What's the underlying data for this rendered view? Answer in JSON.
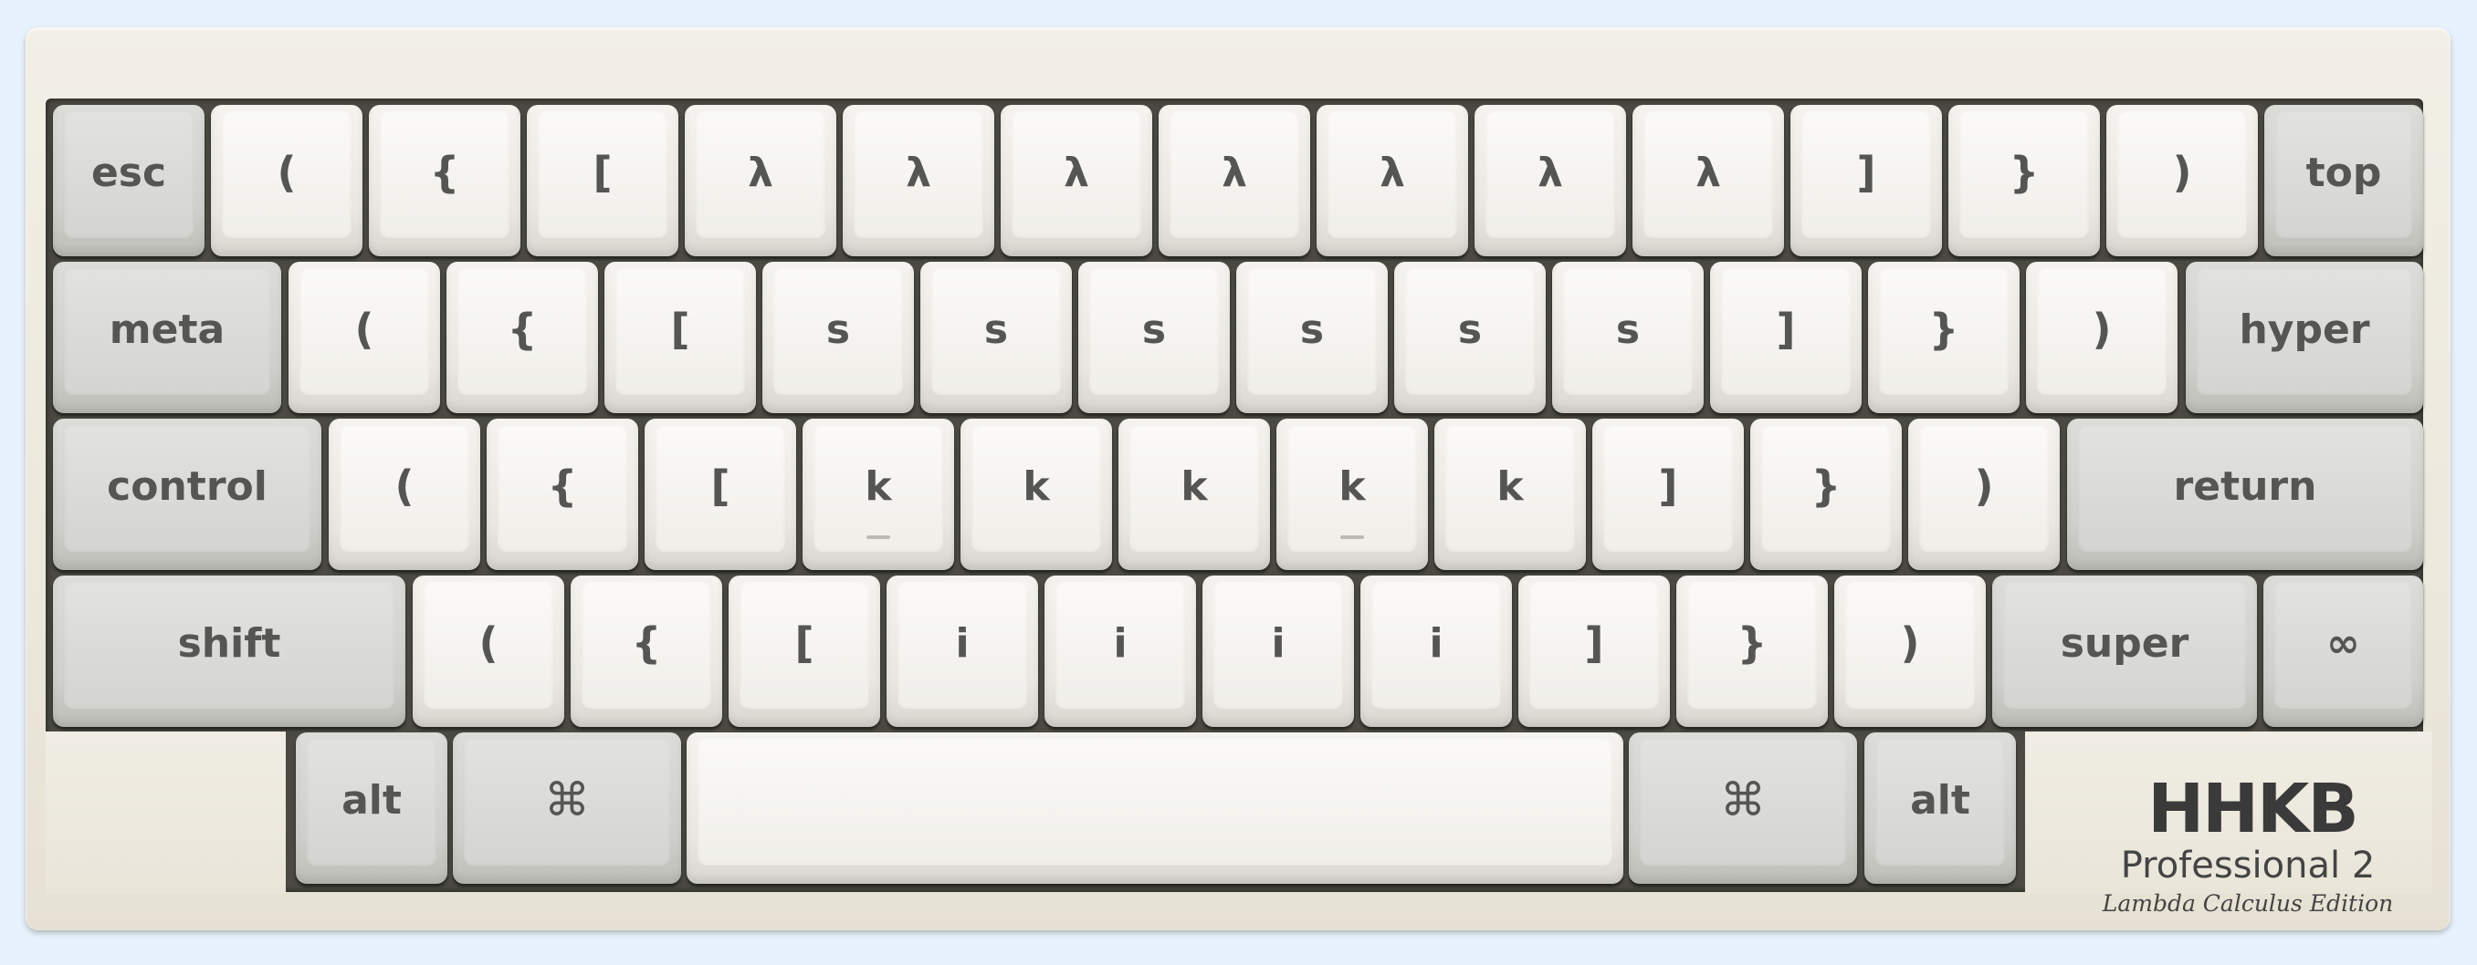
{
  "keyboard": {
    "row1": {
      "esc": "esc",
      "k1": "(",
      "k2": "{",
      "k3": "[",
      "k4": "λ",
      "k5": "λ",
      "k6": "λ",
      "k7": "λ",
      "k8": "λ",
      "k9": "λ",
      "k10": "λ",
      "k11": "]",
      "k12": "}",
      "k13": ")",
      "top": "top"
    },
    "row2": {
      "meta": "meta",
      "k1": "(",
      "k2": "{",
      "k3": "[",
      "k4": "s",
      "k5": "s",
      "k6": "s",
      "k7": "s",
      "k8": "s",
      "k9": "s",
      "k10": "]",
      "k11": "}",
      "k12": ")",
      "hyper": "hyper"
    },
    "row3": {
      "control": "control",
      "k1": "(",
      "k2": "{",
      "k3": "[",
      "k4": "k",
      "k5": "k",
      "k6": "k",
      "k7": "k",
      "k8": "k",
      "k9": "]",
      "k10": "}",
      "k11": ")",
      "return": "return"
    },
    "row4": {
      "shift": "shift",
      "k1": "(",
      "k2": "{",
      "k3": "[",
      "k4": "i",
      "k5": "i",
      "k6": "i",
      "k7": "i",
      "k8": "]",
      "k9": "}",
      "k10": ")",
      "super": "super",
      "infinity": "∞"
    },
    "row5": {
      "alt_left": "alt",
      "cmd_left": "⌘",
      "space": "",
      "cmd_right": "⌘",
      "alt_right": "alt"
    }
  },
  "logo": {
    "mark": "HHKB",
    "product": "Professional 2",
    "edition": "Lambda Calculus Edition"
  },
  "colors": {
    "case": "#ece8dc",
    "alpha_key": "#f0efea",
    "modifier_key": "#d4d4d0",
    "legend": "#555552",
    "background": "#e8f2fc"
  }
}
